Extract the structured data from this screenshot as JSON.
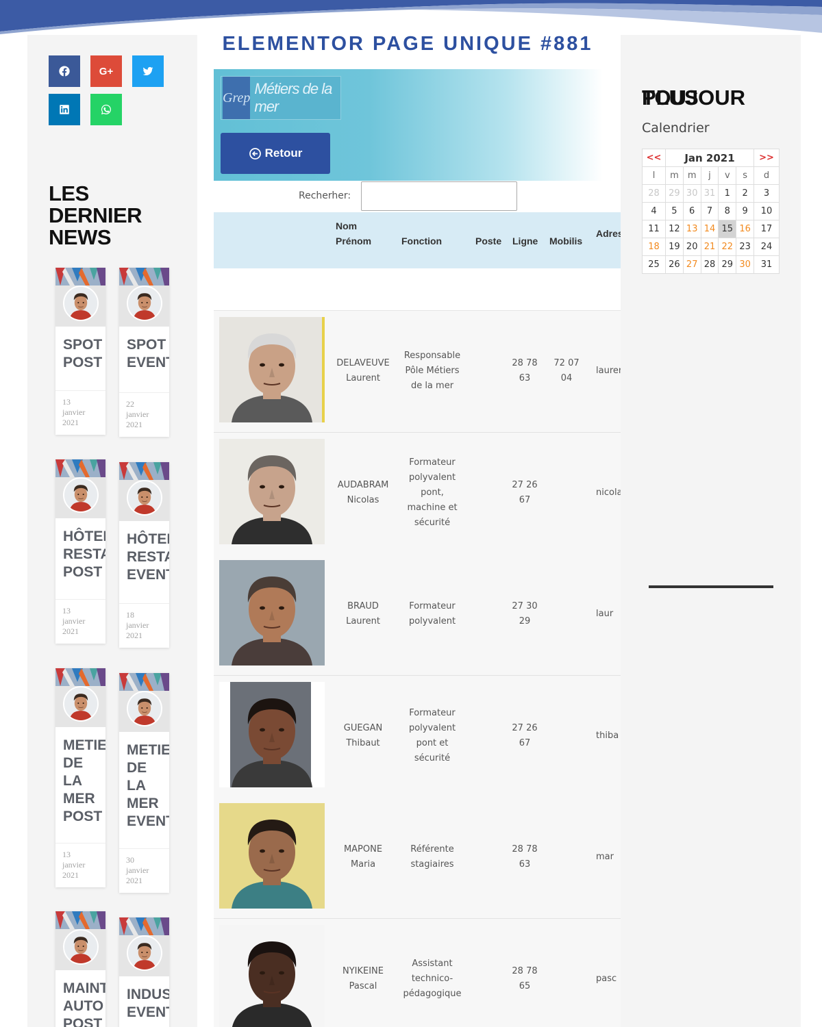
{
  "page": {
    "title": "ELEMENTOR PAGE UNIQUE #881"
  },
  "share": [
    {
      "name": "facebook",
      "icon": "facebook-icon",
      "color": "#3b5998"
    },
    {
      "name": "google-plus",
      "icon": "google-plus-icon",
      "label": "G+",
      "color": "#dd4b39"
    },
    {
      "name": "twitter",
      "icon": "twitter-icon",
      "color": "#1da1f2"
    },
    {
      "name": "linkedin",
      "icon": "linkedin-icon",
      "color": "#0077b5"
    },
    {
      "name": "whatsapp",
      "icon": "whatsapp-icon",
      "color": "#25d366"
    }
  ],
  "news": {
    "heading": [
      "LES",
      "DERNIER",
      "NEWS"
    ],
    "cards": [
      {
        "title": [
          "SPOT",
          "POST"
        ],
        "date": [
          "13",
          "janvier",
          "2021"
        ]
      },
      {
        "title": [
          "SPOT",
          "EVENT"
        ],
        "date": [
          "22",
          "janvier",
          "2021"
        ]
      },
      {
        "title": [
          "HÔTEL",
          "RESTA",
          "POST"
        ],
        "date": [
          "13",
          "janvier",
          "2021"
        ]
      },
      {
        "title": [
          "HÔTEL",
          "RESTA",
          "EVENT"
        ],
        "date": [
          "18",
          "janvier",
          "2021"
        ]
      },
      {
        "title": [
          "METIE",
          "DE",
          "LA",
          "MER",
          "POST"
        ],
        "date": [
          "13",
          "janvier",
          "2021"
        ]
      },
      {
        "title": [
          "METIE",
          "DE",
          "LA",
          "MER",
          "EVENT"
        ],
        "date": [
          "30",
          "janvier",
          "2021"
        ]
      },
      {
        "title": [
          "MAINT",
          "AUTO",
          "POST"
        ],
        "date": []
      },
      {
        "title": [
          "INDUS",
          "EVENT"
        ],
        "date": []
      }
    ]
  },
  "hero": {
    "logo_mark": "Grep",
    "logo_text": "Métiers de la mer",
    "back_label": "Retour",
    "back_icon": "circle-arrow-left-icon"
  },
  "search": {
    "label": "Recherher:",
    "value": ""
  },
  "table": {
    "headers": {
      "nom": "Nom",
      "prenom": "Prénom",
      "fonction": "Fonction",
      "poste": "Poste",
      "ligne": "Ligne",
      "mobilis": "Mobilis",
      "adresse": "Adres"
    },
    "rows": [
      {
        "nom": "DELAVEUVE",
        "prenom": "Laurent",
        "fonction": [
          "Responsable",
          "Pôle Métiers",
          "de la mer"
        ],
        "ligne": [
          "28 78",
          "63"
        ],
        "mobilis": [
          "72 07",
          "04"
        ],
        "adresse": "laurer"
      },
      {
        "nom": "AUDABRAM",
        "prenom": "Nicolas",
        "fonction": [
          "Formateur",
          "polyvalent",
          "pont,",
          "machine et",
          "sécurité"
        ],
        "ligne": [
          "27 26",
          "67"
        ],
        "mobilis": [],
        "adresse": "nicola"
      },
      {
        "nom": "BRAUD",
        "prenom": "Laurent",
        "fonction": [
          "Formateur",
          "polyvalent"
        ],
        "ligne": [
          "27 30",
          "29"
        ],
        "mobilis": [],
        "adresse": "laur"
      },
      {
        "nom": "GUEGAN",
        "prenom": "Thibaut",
        "fonction": [
          "Formateur",
          "polyvalent",
          "pont et",
          "sécurité"
        ],
        "ligne": [
          "27 26",
          "67"
        ],
        "mobilis": [],
        "adresse": "thiba"
      },
      {
        "nom": "MAPONE",
        "prenom": "Maria",
        "fonction": [
          "Référente",
          "stagiaires"
        ],
        "ligne": [
          "28 78",
          "63"
        ],
        "mobilis": [],
        "adresse": "mar"
      },
      {
        "nom": "NYIKEINE",
        "prenom": "Pascal",
        "fonction": [
          "Assistant",
          "technico-",
          "pédagogique"
        ],
        "ligne": [
          "28 78",
          "65"
        ],
        "mobilis": [],
        "adresse": "pasc"
      }
    ]
  },
  "right": {
    "title_a": "TOUJOUR",
    "title_b": "PLUS",
    "calendar_label": "Calendrier",
    "calendar": {
      "prev": "<<",
      "next": ">>",
      "month": "Jan 2021",
      "daynames": [
        "l",
        "m",
        "m",
        "j",
        "v",
        "s",
        "d"
      ],
      "weeks": [
        [
          "28",
          "29",
          "30",
          "31",
          "1",
          "2",
          "3"
        ],
        [
          "4",
          "5",
          "6",
          "7",
          "8",
          "9",
          "10"
        ],
        [
          "11",
          "12",
          "13",
          "14",
          "15",
          "16",
          "17"
        ],
        [
          "18",
          "19",
          "20",
          "21",
          "22",
          "23",
          "24"
        ],
        [
          "25",
          "26",
          "27",
          "28",
          "29",
          "30",
          "31"
        ]
      ],
      "today": "15",
      "event_color": "#f28a1f",
      "nav_color": "#dd3333"
    }
  }
}
